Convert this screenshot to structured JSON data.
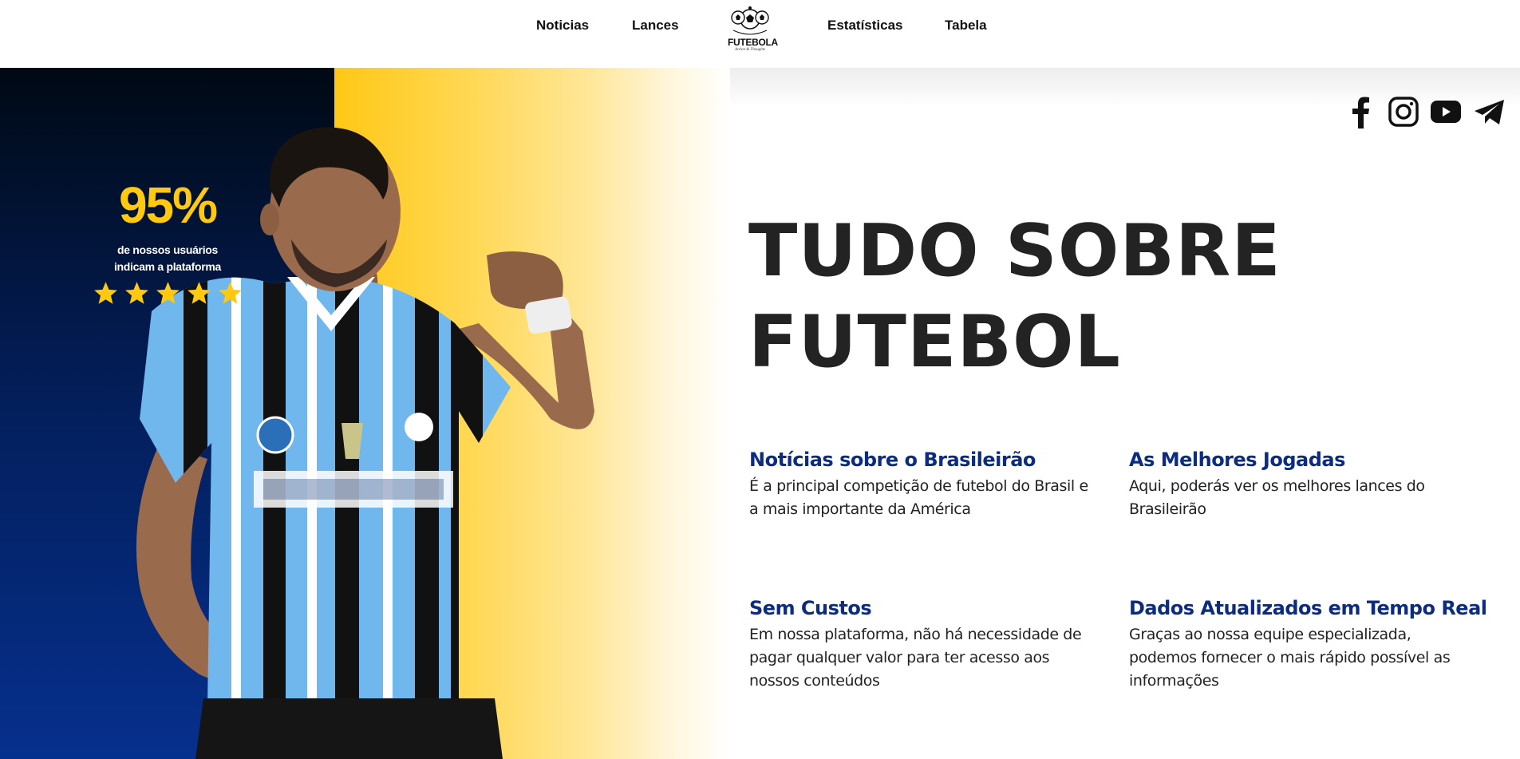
{
  "header": {
    "nav": [
      "Noticias",
      "Lances",
      "Estatísticas",
      "Tabela"
    ],
    "logo": {
      "name": "FUTEBOLA",
      "tagline": "Action & Thoughts"
    }
  },
  "hero": {
    "rating_percent": "95%",
    "rating_caption_line1": "de nossos usuários",
    "rating_caption_line2": "indicam a plataforma",
    "stars": 5,
    "star_color": "#ffc90f",
    "background_colors": {
      "blue": "#031d57",
      "yellow": "#ffc816"
    }
  },
  "social": [
    "facebook-icon",
    "instagram-icon",
    "youtube-icon",
    "telegram-icon"
  ],
  "headline": {
    "line1": "TUDO SOBRE",
    "line2": "FUTEBOL"
  },
  "features": [
    {
      "title": "Notícias sobre o Brasileirão",
      "text": "É a principal competição de futebol do Brasil e a mais importante da América"
    },
    {
      "title": "As Melhores Jogadas",
      "text": "Aqui, poderás ver os melhores lances do Brasileirão"
    },
    {
      "title": "Sem Custos",
      "text": "Em nossa plataforma, não há necessidade de pagar qualquer valor para ter acesso aos nossos conteúdos"
    },
    {
      "title": "Dados Atualizados em Tempo Real",
      "text": "Graças ao nossa equipe especializada, podemos fornecer o mais rápido possível as informações"
    }
  ],
  "colors": {
    "accent_blue": "#0b2c80",
    "headline": "#232323"
  }
}
